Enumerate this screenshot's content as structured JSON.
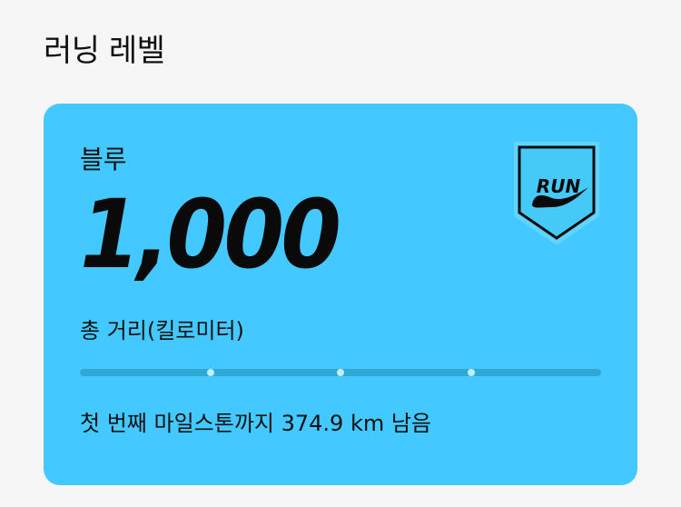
{
  "header": {
    "title": "러닝 레벨"
  },
  "level_card": {
    "level_name": "블루",
    "total_distance": "1,000",
    "distance_label": "총 거리(킬로미터)",
    "progress": {
      "fill_fraction": 0.0,
      "milestones": [
        0.25,
        0.5,
        0.75
      ]
    },
    "milestone_text": "첫 번째 마일스톤까지 374.9 km 남음",
    "badge_text": "RUN",
    "badge_icon": "run-badge-icon",
    "card_color": "#43c9ff"
  }
}
